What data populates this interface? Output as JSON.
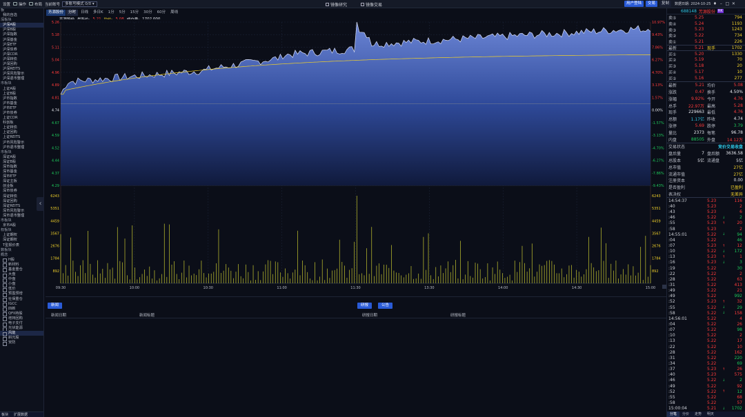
{
  "topbar": {
    "menu": [
      "设置",
      "操作",
      "布局",
      "当前账号"
    ],
    "mode": "多账号模式 0/0",
    "center": [
      "镜像研究",
      "镜像交易"
    ],
    "buttons": [
      "用户登陆",
      "交易",
      "复制"
    ],
    "date": "数据日期: 2024-10-25"
  },
  "sidebar": {
    "items": [
      {
        "t": "板",
        "k": "cat"
      },
      {
        "t": "我的自选",
        "k": "it"
      },
      {
        "t": "深板块",
        "k": "cat"
      },
      {
        "t": "沪深A股",
        "k": "sel"
      },
      {
        "t": "沪深B股",
        "k": "it"
      },
      {
        "t": "沪深指数",
        "k": "it"
      },
      {
        "t": "沪深基金",
        "k": "it"
      },
      {
        "t": "沪深ETF",
        "k": "it"
      },
      {
        "t": "沪深债券",
        "k": "it"
      },
      {
        "t": "沪深CDR",
        "k": "it"
      },
      {
        "t": "沪深转债",
        "k": "it"
      },
      {
        "t": "沪深回购",
        "k": "it"
      },
      {
        "t": "沪深REITS",
        "k": "it"
      },
      {
        "t": "沪深风险警示",
        "k": "it"
      },
      {
        "t": "沪深退市整理",
        "k": "it"
      },
      {
        "t": "市板块",
        "k": "cat"
      },
      {
        "t": "上证A股",
        "k": "it"
      },
      {
        "t": "上证B股",
        "k": "it"
      },
      {
        "t": "沪市指数",
        "k": "it"
      },
      {
        "t": "沪市基金",
        "k": "it"
      },
      {
        "t": "沪市ETF",
        "k": "it"
      },
      {
        "t": "沪市债券",
        "k": "it"
      },
      {
        "t": "上证CDR",
        "k": "it"
      },
      {
        "t": "科创板",
        "k": "it"
      },
      {
        "t": "上证转债",
        "k": "it"
      },
      {
        "t": "上证回购",
        "k": "it"
      },
      {
        "t": "上证REITS",
        "k": "it"
      },
      {
        "t": "沪市风险警示",
        "k": "it"
      },
      {
        "t": "沪市退市整理",
        "k": "it"
      },
      {
        "t": "市板块",
        "k": "cat"
      },
      {
        "t": "深证A股",
        "k": "it"
      },
      {
        "t": "深证B股",
        "k": "it"
      },
      {
        "t": "深市指数",
        "k": "it"
      },
      {
        "t": "深市基金",
        "k": "it"
      },
      {
        "t": "深市ETF",
        "k": "it"
      },
      {
        "t": "深证主板",
        "k": "it"
      },
      {
        "t": "创业板",
        "k": "it"
      },
      {
        "t": "深市债券",
        "k": "it"
      },
      {
        "t": "深证转债",
        "k": "it"
      },
      {
        "t": "深证回购",
        "k": "it"
      },
      {
        "t": "深证REITS",
        "k": "it"
      },
      {
        "t": "深市风险警示",
        "k": "it"
      },
      {
        "t": "深市退市整理",
        "k": "it"
      },
      {
        "t": "市板块",
        "k": "cat"
      },
      {
        "t": "京市A股",
        "k": "it"
      },
      {
        "t": "权板块",
        "k": "cat"
      },
      {
        "t": "上证期权",
        "k": "it"
      },
      {
        "t": "深证期权",
        "k": "it"
      },
      {
        "t": "T型报价表",
        "k": "it"
      },
      {
        "t": "数板块",
        "k": "cat"
      },
      {
        "t": "概念",
        "k": "cat"
      },
      {
        "t": "H股",
        "k": "leaf"
      },
      {
        "t": "新材料",
        "k": "leaf"
      },
      {
        "t": "基金重仓",
        "k": "leaf"
      },
      {
        "t": "大盘",
        "k": "leaf"
      },
      {
        "t": "中盘",
        "k": "leaf"
      },
      {
        "t": "小盘",
        "k": "leaf"
      },
      {
        "t": "低价",
        "k": "leaf"
      },
      {
        "t": "预盈预增",
        "k": "leaf"
      },
      {
        "t": "社保重仓",
        "k": "leaf"
      },
      {
        "t": "IGCC",
        "k": "leaf"
      },
      {
        "t": "四新",
        "k": "leaf"
      },
      {
        "t": "QFII持股",
        "k": "leaf"
      },
      {
        "t": "增持回购",
        "k": "leaf"
      },
      {
        "t": "电子支付",
        "k": "leaf"
      },
      {
        "t": "光伏能源",
        "k": "leaf"
      },
      {
        "t": "风能",
        "k": "leafsel"
      },
      {
        "t": "斜元股",
        "k": "leaf"
      },
      {
        "t": "安防",
        "k": "leaf"
      }
    ],
    "bottom": [
      "板块",
      "扩展数据"
    ]
  },
  "chart_tabs": [
    "芳源股份",
    "分时",
    "日线",
    "多日K",
    "1分",
    "5分",
    "15分",
    "30分",
    "60分",
    "周线"
  ],
  "chart_info": {
    "name": "芳源股份",
    "latest_label": "最新价:",
    "latest": "5.21",
    "avg_label": "均价:",
    "avg": "5.08",
    "vol_label": "成交量:",
    "vol": "1702.000"
  },
  "chart_data": {
    "type": "area",
    "price_ticks": [
      "5.26",
      "5.18",
      "5.11",
      "5.04",
      "4.96",
      "4.89",
      "4.81",
      "4.74",
      "4.67",
      "4.59",
      "4.52",
      "4.44",
      "4.37",
      "4.29"
    ],
    "pct_ticks": [
      "10.97%",
      "9.43%",
      "7.86%",
      "6.27%",
      "4.70%",
      "3.13%",
      "1.57%",
      "0.00%",
      "-1.57%",
      "-3.13%",
      "-4.70%",
      "-6.27%",
      "-7.86%",
      "-9.43%"
    ],
    "vol_ticks": [
      "6243",
      "5351",
      "4459",
      "3567",
      "2676",
      "1784",
      "892"
    ],
    "time_ticks": [
      "09:30",
      "10:00",
      "10:30",
      "11:00",
      "11:30",
      "13:30",
      "14:00",
      "14:30",
      "15:00"
    ],
    "preclose": 4.74,
    "ylim": [
      4.22,
      5.26
    ],
    "vol_max": 6243
  },
  "news": {
    "btn_left": "新闻",
    "btn_mid": "研报",
    "btn_mid2": "公告",
    "col_date": "新闻日期",
    "col_title": "新闻标题",
    "col_rdate": "研报日期",
    "col_rtitle": "研报标题"
  },
  "quote": {
    "code": "688148",
    "name": "芳源股份",
    "badge": "RK",
    "asks": [
      [
        "卖⑤",
        "5.25",
        "794"
      ],
      [
        "卖④",
        "5.24",
        "1193"
      ],
      [
        "卖③",
        "5.23",
        "1243"
      ],
      [
        "卖②",
        "5.22",
        "734"
      ],
      [
        "卖①",
        "5.21",
        "226"
      ]
    ],
    "latest": [
      "最新",
      "5.21",
      "现手",
      "1702"
    ],
    "bids": [
      [
        "买①",
        "5.20",
        "1330"
      ],
      [
        "买②",
        "5.19",
        "70"
      ],
      [
        "买③",
        "5.18",
        "20"
      ],
      [
        "买④",
        "5.17",
        "10"
      ],
      [
        "买⑤",
        "5.16",
        "277"
      ]
    ],
    "stats": [
      [
        "最新",
        "5.21",
        "均价",
        "5.08",
        "red",
        "red"
      ],
      [
        "涨跌",
        "0.47",
        "换手",
        "4.50%",
        "red",
        "white"
      ],
      [
        "涨幅",
        "9.92%",
        "今开",
        "4.76",
        "red",
        "red"
      ],
      [
        "总手",
        "22.97万",
        "最高",
        "5.28",
        "red",
        "red"
      ],
      [
        "现手",
        "229663",
        "最低",
        "4.76",
        "white",
        "red"
      ],
      [
        "总额",
        "1.17亿",
        "昨收",
        "4.74",
        "cyan",
        "white"
      ],
      [
        "涨停",
        "5.69",
        "跌停",
        "3.79",
        "red",
        "green"
      ],
      [
        "量比",
        "2373",
        "每笔",
        "96.78",
        "white",
        "white"
      ],
      [
        "内盘",
        "88505",
        "外盘",
        "14.12万",
        "green",
        "red"
      ]
    ],
    "status": [
      "交易状态",
      "",
      "",
      "竞价交易收盘"
    ],
    "info": [
      [
        "盘后量",
        "7",
        "盘后额",
        "3636.58"
      ],
      [
        "总股本",
        "5亿",
        "流通盘",
        "5亿"
      ],
      [
        "总市值",
        "",
        "",
        "27亿"
      ],
      [
        "流通市值",
        "",
        "",
        "27亿"
      ],
      [
        "注册资本",
        "",
        "",
        "0.00"
      ],
      [
        "是否盈利",
        "",
        "",
        "已盈利"
      ],
      [
        "表决权",
        "",
        "",
        "无差异"
      ]
    ]
  },
  "ticks": [
    [
      "14:54:37",
      "5.23",
      "",
      "116",
      "red"
    ],
    [
      ":40",
      "5.23",
      "",
      "2",
      "red"
    ],
    [
      ":43",
      "5.23",
      "",
      "6",
      "red"
    ],
    [
      ":46",
      "5.22",
      "↓",
      "2",
      "green"
    ],
    [
      ":55",
      "5.23",
      "↑",
      "20",
      "red"
    ],
    [
      ":58",
      "5.23",
      "",
      "2",
      "red"
    ],
    [
      "14:55:01",
      "5.22",
      "↓",
      "94",
      "green"
    ],
    [
      ":04",
      "5.22",
      "",
      "46",
      "green"
    ],
    [
      ":07",
      "5.23",
      "↑",
      "12",
      "red"
    ],
    [
      ":10",
      "5.22",
      "↓",
      "172",
      "green"
    ],
    [
      ":13",
      "5.23",
      "↑",
      "1",
      "red"
    ],
    [
      ":16",
      "5.23",
      "↓",
      "3",
      "green"
    ],
    [
      ":19",
      "5.22",
      "",
      "30",
      "green"
    ],
    [
      ":22",
      "5.22",
      "",
      "2",
      "red"
    ],
    [
      ":28",
      "5.22",
      "",
      "63",
      "red"
    ],
    [
      ":31",
      "5.22",
      "",
      "413",
      "red"
    ],
    [
      ":49",
      "5.22",
      "",
      "21",
      "red"
    ],
    [
      ":49",
      "5.22",
      "",
      "992",
      "green"
    ],
    [
      ":52",
      "5.23",
      "↑",
      "32",
      "red"
    ],
    [
      ":55",
      "5.22",
      "↓",
      "29",
      "green"
    ],
    [
      ":58",
      "5.22",
      "↓",
      "158",
      "red"
    ],
    [
      "14:56:01",
      "5.22",
      "",
      "4",
      "red"
    ],
    [
      ":04",
      "5.22",
      "",
      "26",
      "red"
    ],
    [
      ":07",
      "5.22",
      "",
      "98",
      "green"
    ],
    [
      ":10",
      "5.22",
      "",
      "2",
      "red"
    ],
    [
      ":13",
      "5.22",
      "",
      "17",
      "red"
    ],
    [
      ":22",
      "5.22",
      "",
      "10",
      "red"
    ],
    [
      ":28",
      "5.22",
      "",
      "162",
      "red"
    ],
    [
      ":31",
      "5.22",
      "",
      "220",
      "green"
    ],
    [
      ":34",
      "5.22",
      "",
      "69",
      "green"
    ],
    [
      ":37",
      "5.23",
      "↑",
      "26",
      "red"
    ],
    [
      ":40",
      "5.23",
      "",
      "575",
      "red"
    ],
    [
      ":46",
      "5.22",
      "↓",
      "2",
      "green"
    ],
    [
      ":49",
      "5.22",
      "",
      "92",
      "red"
    ],
    [
      ":52",
      "5.22",
      "↑",
      "12",
      "green"
    ],
    [
      ":55",
      "5.22",
      "",
      "68",
      "red"
    ],
    [
      ":58",
      "5.22",
      "",
      "57",
      "red"
    ],
    [
      "15:00:04",
      "5.21",
      "↓",
      "1702",
      "green"
    ],
    [
      "15:24:43",
      "5.21",
      "",
      "7",
      "cur"
    ]
  ],
  "right_tabs": [
    "分笔",
    "分价",
    "走势",
    "明天"
  ]
}
